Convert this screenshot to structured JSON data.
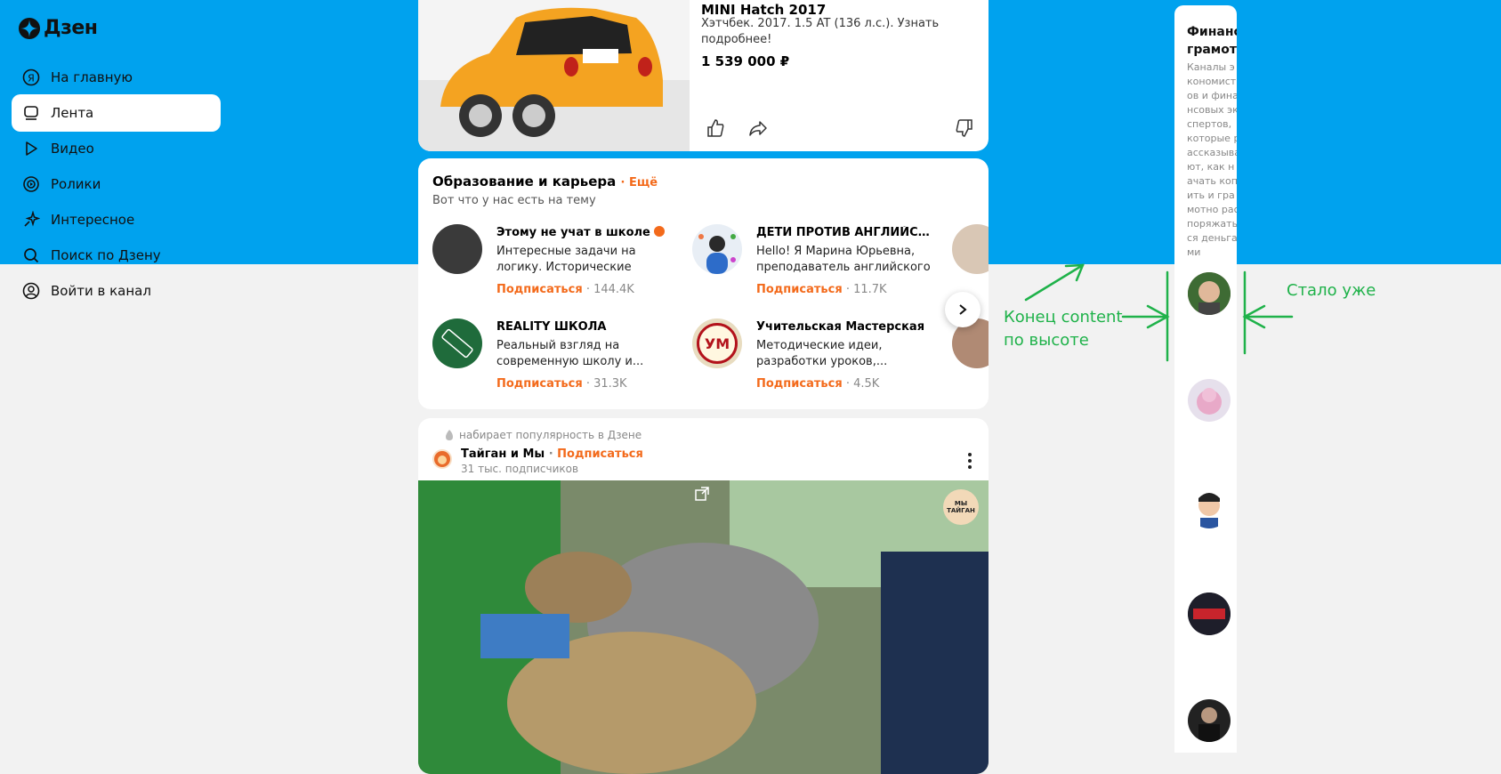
{
  "sidebar": {
    "logo": "Дзен",
    "items": [
      {
        "label": "На главную",
        "icon": "yandex-icon"
      },
      {
        "label": "Лента",
        "icon": "feed-icon",
        "active": true
      },
      {
        "label": "Видео",
        "icon": "play-icon"
      },
      {
        "label": "Ролики",
        "icon": "shorts-icon"
      },
      {
        "label": "Интересное",
        "icon": "sparkle-icon"
      },
      {
        "label": "Поиск по Дзену",
        "icon": "search-icon"
      },
      {
        "label": "Войти в канал",
        "icon": "user-icon"
      }
    ]
  },
  "ad": {
    "title": "MINI Hatch 2017",
    "description": "Хэтчбек. 2017. 1.5 AT (136 л.с.). Узнать подробнее!",
    "price": "1 539 000 ₽"
  },
  "education": {
    "title": "Образование и карьера",
    "more": "Ещё",
    "subtitle": "Вот что у нас есть на тему",
    "channels": [
      {
        "name": "Этому не учат в школе",
        "desc": "Интересные задачи на логику. Исторические анекдоты. И...",
        "subscribe": "Подписаться",
        "count": "· 144.4K"
      },
      {
        "name": "ДЕТИ ПРОТИВ АНГЛИЙСК...",
        "desc": "Hello! Я Марина Юрьевна, преподаватель английского ...",
        "subscribe": "Подписаться",
        "count": "· 11.7K"
      },
      {
        "name": "REALITY ШКОЛА",
        "desc": "Реальный взгляд на современную школу и...",
        "subscribe": "Подписаться",
        "count": "· 31.3K"
      },
      {
        "name": "Учительская Мастерская",
        "desc": "Методические идеи, разработки уроков,...",
        "subscribe": "Подписаться",
        "count": "· 4.5K"
      }
    ],
    "avatar_labels": {
      "um": "УМ"
    }
  },
  "post": {
    "trend": "набирает популярность в Дзене",
    "author": "Тайган и Мы",
    "subscribe": "Подписаться",
    "followers": "31 тыс. подписчиков",
    "badge": "МЫ ТАЙГАН"
  },
  "right_panel": {
    "title": "Финансовая грамотность",
    "description": "Каналы экономистов и финансовых экспертов, которые рассказывают, как начать копить и грамотно распоряжаться деньгами"
  },
  "annotations": {
    "left": "Конец content\nпо высоте",
    "right": "Стало уже"
  },
  "colors": {
    "brand_blue": "#00a2ee",
    "accent_orange": "#f36a1b",
    "annotation_green": "#1fb24a"
  }
}
